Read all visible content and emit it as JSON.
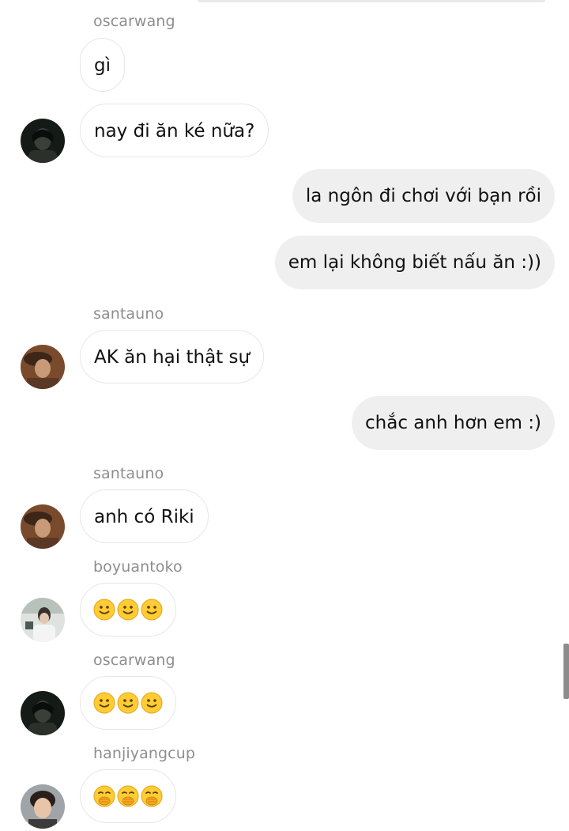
{
  "messages": [
    {
      "sender": "oscarwang",
      "text": "gì"
    },
    {
      "text": "nay đi ăn ké nữa?"
    },
    {
      "text": "la ngôn đi chơi với bạn rồi"
    },
    {
      "text": "em lại không biết nấu ăn :))"
    },
    {
      "sender": "santauno",
      "text": "AK ăn hại thật sự"
    },
    {
      "text": "chắc anh hơn em :)"
    },
    {
      "sender": "santauno",
      "text": "anh có Riki"
    },
    {
      "sender": "boyuantoko",
      "emoji": "slightly-smiling-face x3"
    },
    {
      "sender": "oscarwang",
      "emoji": "slightly-smiling-face x3"
    },
    {
      "sender": "hanjiyangcup",
      "emoji": "face-with-hand-over-mouth x3"
    }
  ],
  "colors": {
    "outgoing_bubble": "#efefef",
    "incoming_border": "#e6e6e6",
    "sender_name": "#8e8e8e"
  }
}
